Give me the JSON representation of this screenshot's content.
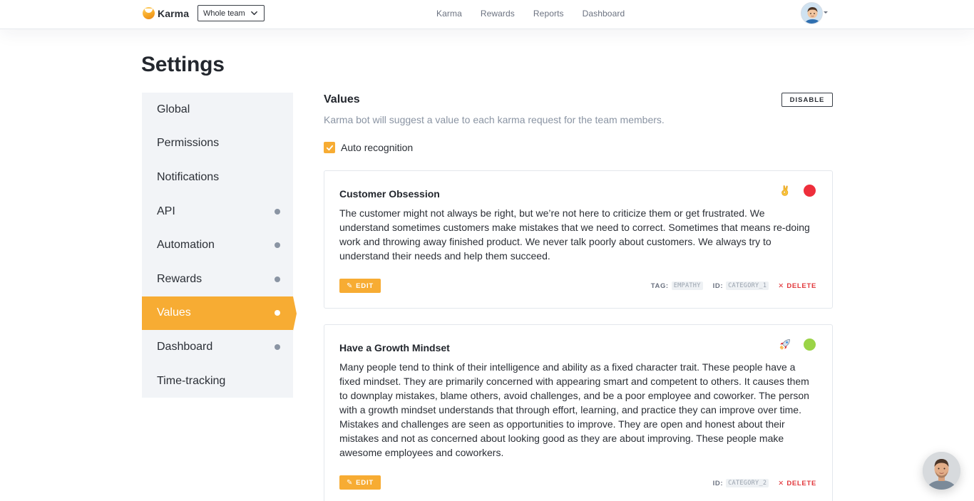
{
  "topbar": {
    "brand": "Karma",
    "team_select": "Whole team",
    "nav": [
      "Karma",
      "Rewards",
      "Reports",
      "Dashboard"
    ]
  },
  "page": {
    "title": "Settings"
  },
  "sidebar": {
    "items": [
      {
        "label": "Global",
        "dot": false,
        "active": false
      },
      {
        "label": "Permissions",
        "dot": false,
        "active": false
      },
      {
        "label": "Notifications",
        "dot": false,
        "active": false
      },
      {
        "label": "API",
        "dot": true,
        "active": false
      },
      {
        "label": "Automation",
        "dot": true,
        "active": false
      },
      {
        "label": "Rewards",
        "dot": true,
        "active": false
      },
      {
        "label": "Values",
        "dot": true,
        "active": true
      },
      {
        "label": "Dashboard",
        "dot": true,
        "active": false
      },
      {
        "label": "Time-tracking",
        "dot": false,
        "active": false
      }
    ],
    "accent_color": "#f7ac33"
  },
  "values_section": {
    "title": "Values",
    "disable_label": "DISABLE",
    "description": "Karma bot will suggest a value to each karma request for the team members.",
    "auto_recognition": {
      "label": "Auto recognition",
      "checked": true
    }
  },
  "cards": [
    {
      "title": "Customer Obsession",
      "emoji": "ok-hand-emoji",
      "color": "#ee2e3b",
      "text": "The customer might not always be right, but we’re not here to criticize them or get frustrated. We understand sometimes customers make mistakes that we need to correct. Sometimes that means re-doing work and throwing away finished product. We never talk poorly about customers. We always try to understand their needs and help them succeed.",
      "edit_label": "EDIT",
      "tag_label": "TAG:",
      "tag": "EMPATHY",
      "id_label": "ID:",
      "id": "CATEGORY_1",
      "delete_label": "DELETE"
    },
    {
      "title": "Have a Growth Mindset",
      "emoji": "rocket-emoji",
      "color": "#9bd447",
      "text": "Many people tend to think of their intelligence and ability as a fixed character trait. These people have a fixed mindset. They are primarily concerned with appearing smart and competent to others. It causes them to downplay mistakes, blame others, avoid challenges, and be a poor employee and coworker. The person with a growth mindset understands that through effort, learning, and practice they can improve over time. Mistakes and challenges are seen as opportunities to improve. They are open and honest about their mistakes and not as concerned about looking good as they are about improving. These people make awesome employees and coworkers.",
      "edit_label": "EDIT",
      "id_label": "ID:",
      "id": "CATEGORY_2",
      "delete_label": "DELETE"
    }
  ]
}
